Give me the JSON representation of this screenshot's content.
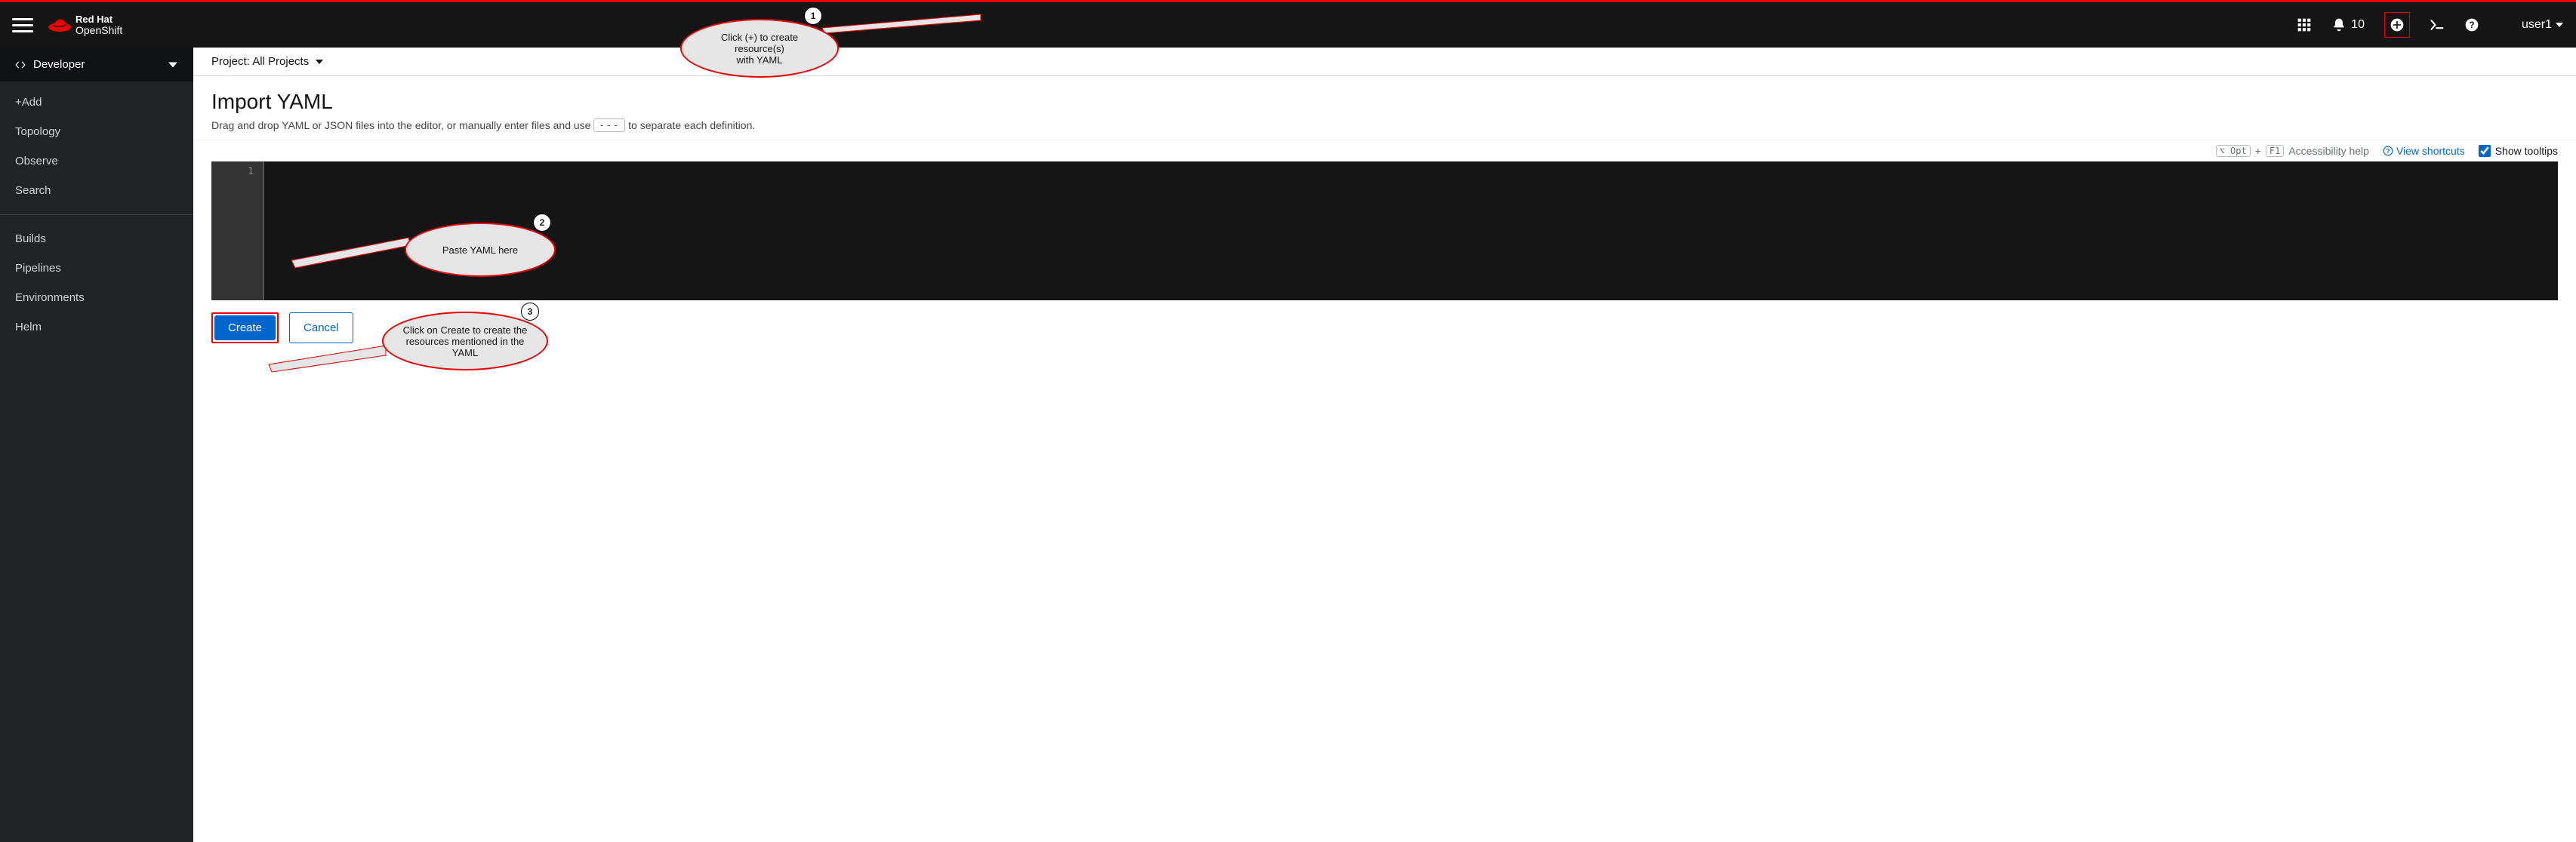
{
  "brand": {
    "line1": "Red Hat",
    "line2": "OpenShift"
  },
  "masthead": {
    "notif_count": "10",
    "user": "user1"
  },
  "sidebar": {
    "perspective": "Developer",
    "items1": [
      "+Add",
      "Topology",
      "Observe",
      "Search"
    ],
    "items2": [
      "Builds",
      "Pipelines",
      "Environments",
      "Helm"
    ]
  },
  "project_bar": {
    "label": "Project: All Projects"
  },
  "page": {
    "title": "Import YAML",
    "subtitle_pre": "Drag and drop YAML or JSON files into the editor, or manually enter files and use",
    "subtitle_sep": "---",
    "subtitle_post": "to separate each definition."
  },
  "toolbar": {
    "accessibility": "Accessibility help",
    "opt_key": "⌥ Opt",
    "plus": "+",
    "f1_key": "F1",
    "view_shortcuts": "View shortcuts",
    "show_tooltips": "Show tooltips"
  },
  "editor": {
    "line_no": "1"
  },
  "buttons": {
    "create": "Create",
    "cancel": "Cancel"
  },
  "callouts": {
    "c1": {
      "num": "1",
      "text1": "Click (+) to create resource(s)",
      "text2": "with YAML"
    },
    "c2": {
      "num": "2",
      "text": "Paste YAML here"
    },
    "c3": {
      "num": "3",
      "text1": "Click on Create to create the",
      "text2": "resources mentioned in the YAML"
    }
  }
}
